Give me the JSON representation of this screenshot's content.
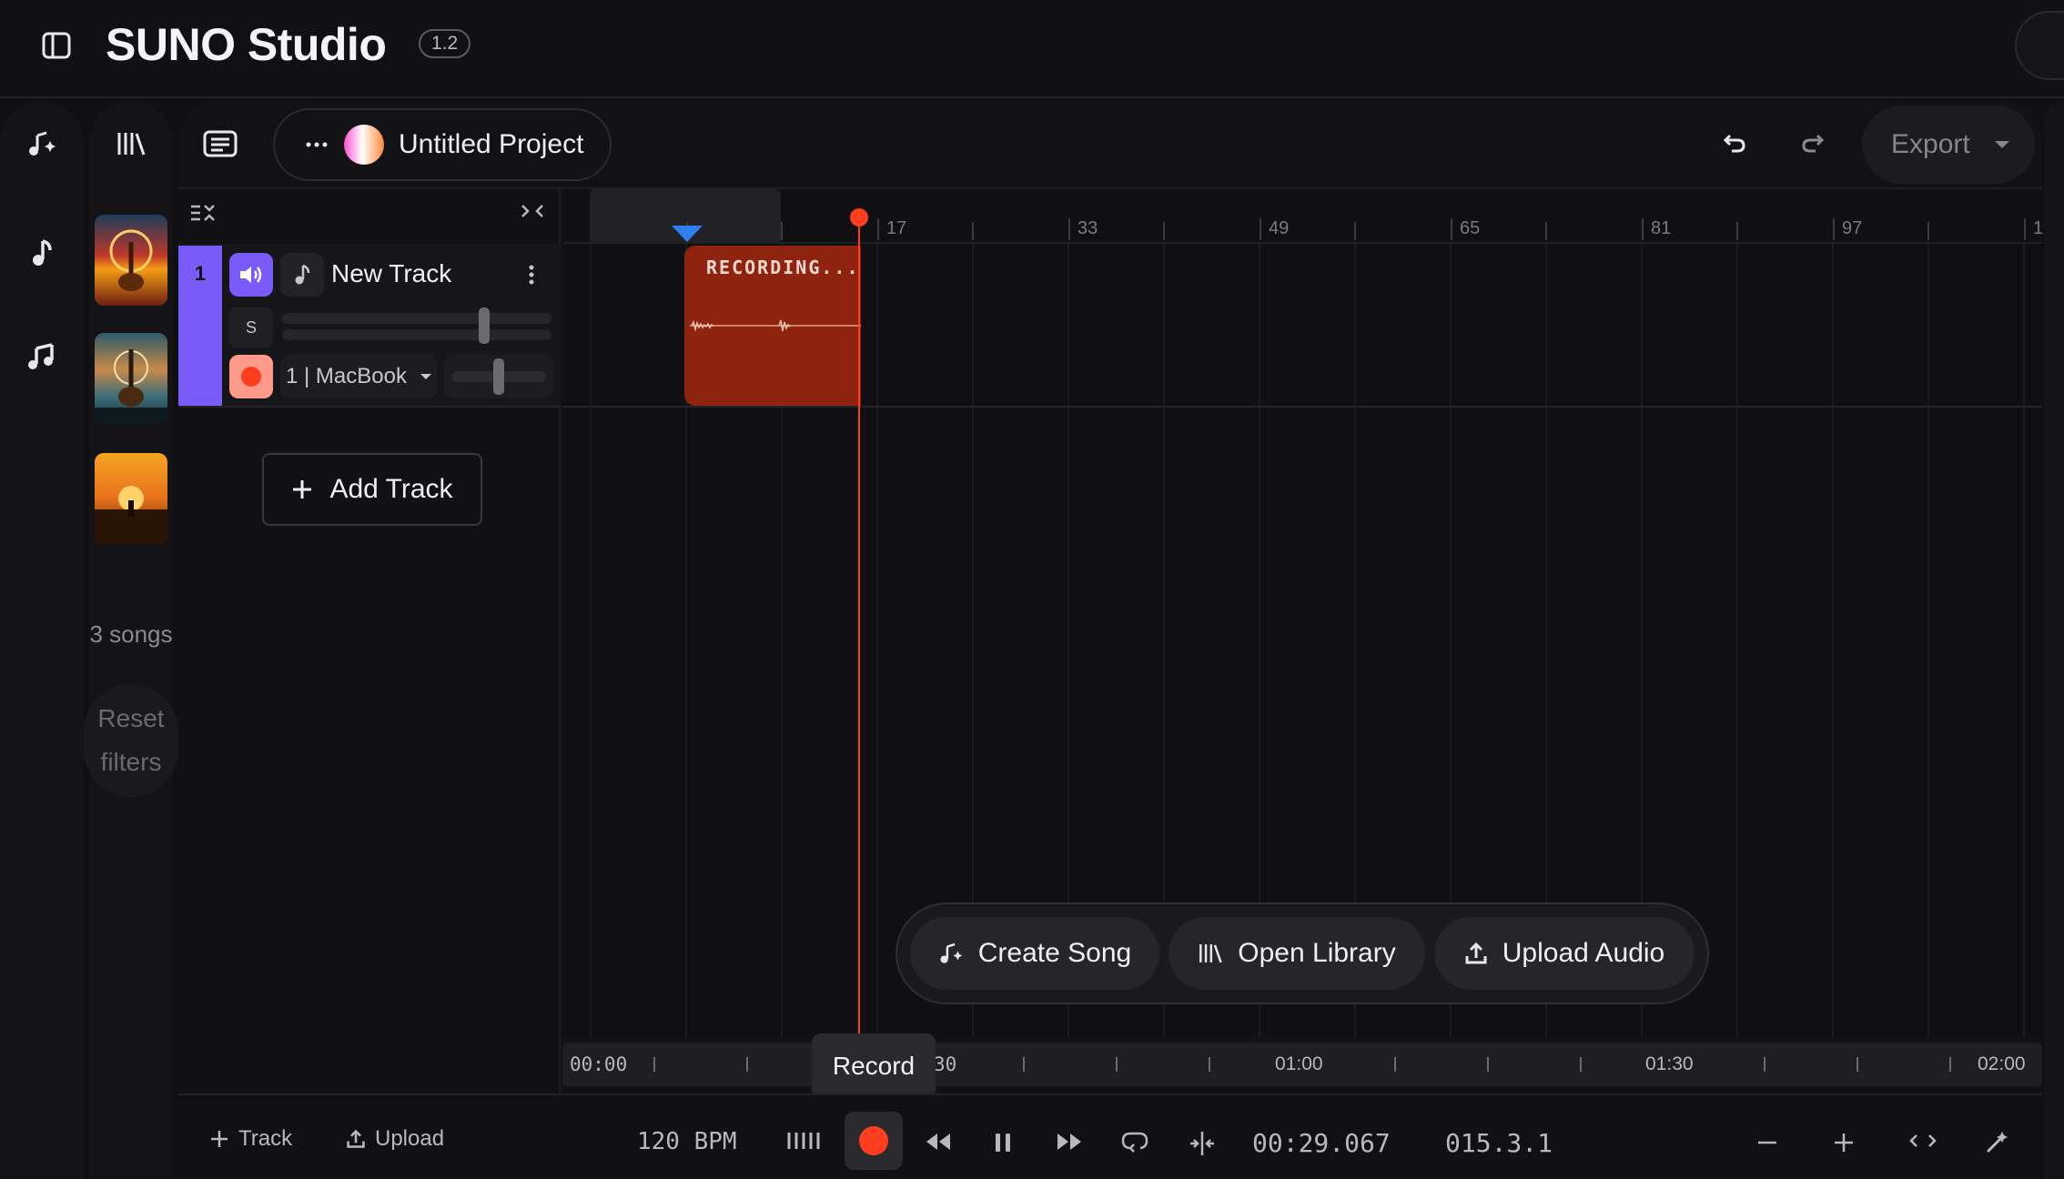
{
  "header": {
    "brand": "SUNO Studio",
    "version": "1.2"
  },
  "toolbar": {
    "project_name": "Untitled Project",
    "export_label": "Export"
  },
  "track": {
    "number": "1",
    "name": "New Track",
    "solo_label": "S",
    "input_label": "1 | MacBook",
    "volume_level": 0.75,
    "pan_level": 0.5
  },
  "add_track_label": "Add Track",
  "timeline": {
    "ruler_labels": [
      "17",
      "33",
      "49",
      "65",
      "81",
      "97",
      "1"
    ],
    "clip_label": "RECORDING...",
    "time_labels": [
      "00:00",
      "30",
      "01:00",
      "01:30",
      "02:00"
    ]
  },
  "actions": {
    "create_song": "Create Song",
    "open_library": "Open Library",
    "upload_audio": "Upload Audio"
  },
  "tooltip": "Record",
  "transport": {
    "add_track": "Track",
    "upload": "Upload",
    "bpm": "120 BPM",
    "time": "00:29.067",
    "bar_position": "015.3.1"
  },
  "library": {
    "song_count": "3 songs",
    "reset_filters": "Reset filters"
  },
  "colors": {
    "accent_purple": "#7a5af8",
    "record_red": "#ff3d1f",
    "clip_red": "#8e2410",
    "marker_blue": "#2f80ed"
  },
  "icons": {
    "sidebar_toggle": "sidebar-toggle-icon",
    "create": "music-sparkle-icon",
    "library": "library-icon",
    "lyrics": "lyrics-icon"
  }
}
